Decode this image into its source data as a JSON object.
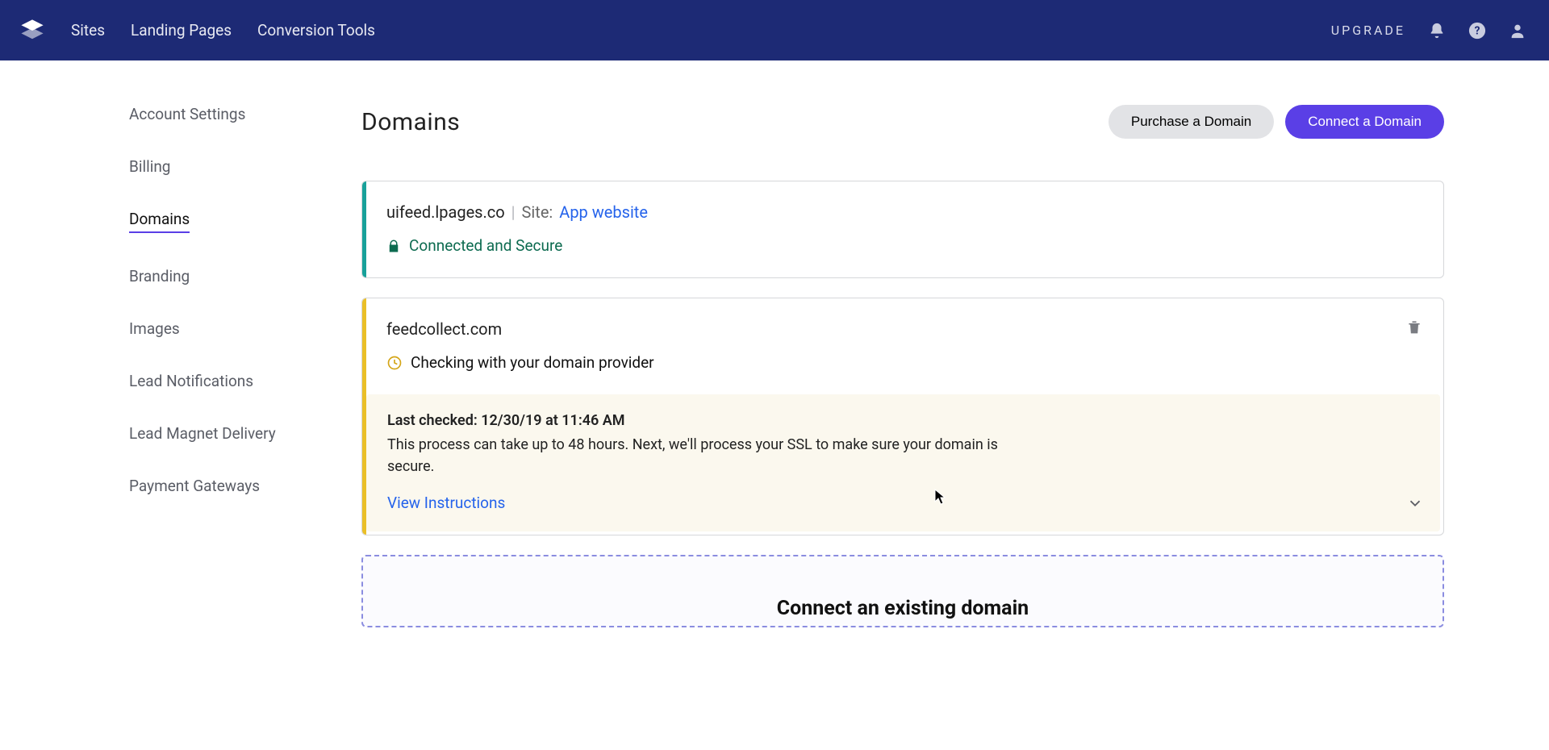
{
  "nav": {
    "links": [
      "Sites",
      "Landing Pages",
      "Conversion Tools"
    ],
    "upgrade": "UPGRADE"
  },
  "sidebar": {
    "items": [
      {
        "label": "Account Settings",
        "active": false
      },
      {
        "label": "Billing",
        "active": false
      },
      {
        "label": "Domains",
        "active": true
      },
      {
        "label": "Branding",
        "active": false
      },
      {
        "label": "Images",
        "active": false
      },
      {
        "label": "Lead Notifications",
        "active": false
      },
      {
        "label": "Lead Magnet Delivery",
        "active": false
      },
      {
        "label": "Payment Gateways",
        "active": false
      }
    ]
  },
  "header": {
    "title": "Domains",
    "purchase_label": "Purchase a Domain",
    "connect_label": "Connect a Domain"
  },
  "domains": [
    {
      "stripe_color": "teal",
      "name": "uifeed.lpages.co",
      "separator": "|",
      "site_prefix": "Site:",
      "site_name": "App website",
      "status_icon": "lock",
      "status_text": "Connected and Secure",
      "status_color": "green",
      "deletable": false
    },
    {
      "stripe_color": "yellow",
      "name": "feedcollect.com",
      "status_icon": "clock",
      "status_text": "Checking with your domain provider",
      "status_color": "default",
      "deletable": true,
      "footer": {
        "last_checked_label": "Last checked: 12/30/19 at 11:46 AM",
        "description": "This process can take up to 48 hours. Next, we'll process your SSL to make sure your domain is secure.",
        "instructions_link": "View Instructions"
      }
    }
  ],
  "connect_box": {
    "heading": "Connect an existing domain"
  }
}
